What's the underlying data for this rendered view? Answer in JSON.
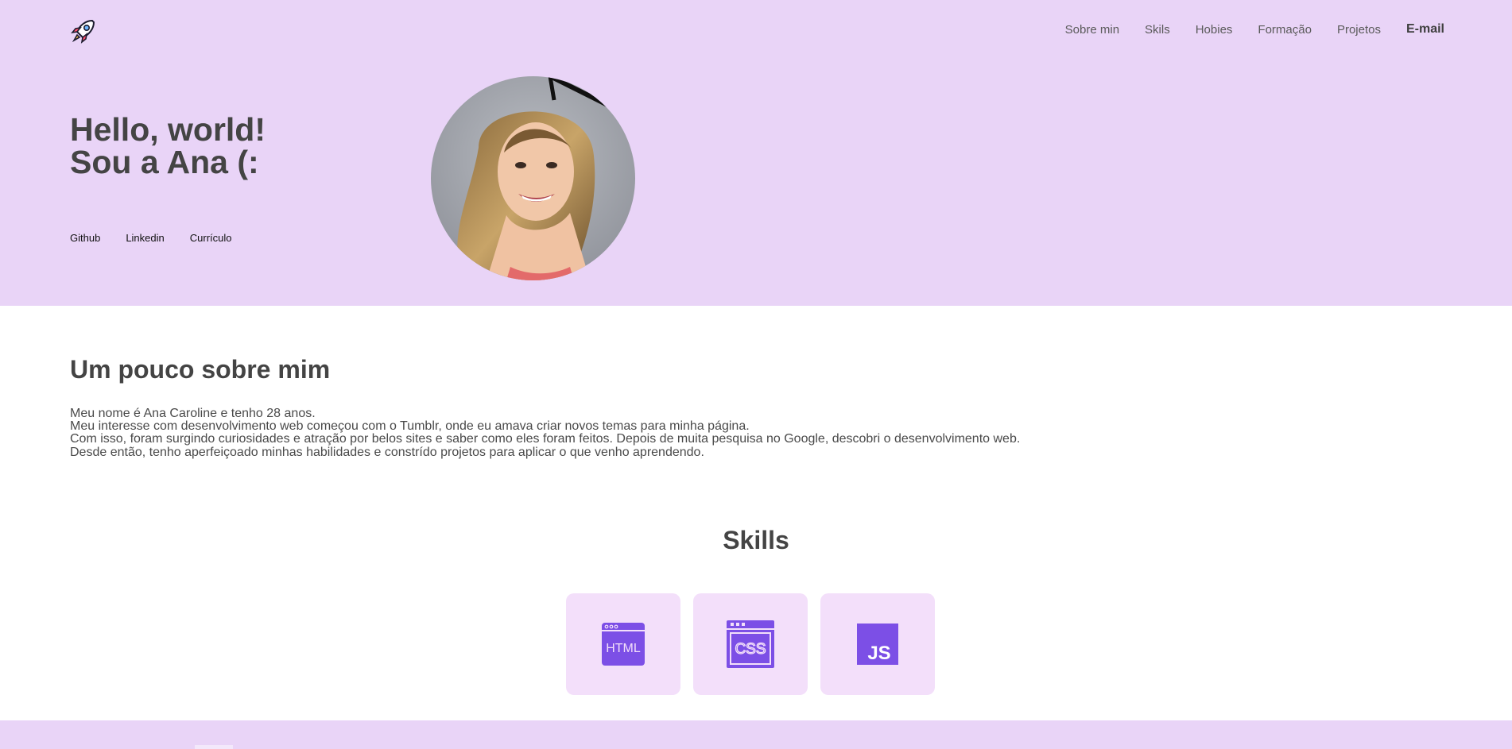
{
  "nav": {
    "items": [
      "Sobre min",
      "Skils",
      "Hobies",
      "Formação",
      "Projetos"
    ],
    "email_label": "E-mail",
    "logo_icon": "rocket-icon"
  },
  "hero": {
    "line1": "Hello, world!",
    "line2": "Sou a Ana (:",
    "links": [
      "Github",
      "Linkedin",
      "Currículo"
    ],
    "photo": "profile-photo"
  },
  "about": {
    "title": "Um pouco sobre mim",
    "paragraphs": [
      "Meu nome é Ana Caroline e tenho 28 anos.",
      "Meu interesse com desenvolvimento web começou com o Tumblr, onde eu amava criar novos temas para minha página.",
      "Com isso, foram surgindo curiosidades e atração por belos sites e saber como eles foram feitos. Depois de muita pesquisa no Google, descobri o desenvolvimento web.",
      "Desde então, tenho aperfeiçoado minhas habilidades e constrído projetos para aplicar o que venho aprendendo."
    ]
  },
  "skills": {
    "title": "Skills",
    "items": [
      {
        "icon": "html-icon",
        "label": "HTML"
      },
      {
        "icon": "css-icon",
        "label": "CSS"
      },
      {
        "icon": "js-icon",
        "label": "JS"
      }
    ]
  },
  "colors": {
    "hero_bg": "#e9d4f7",
    "card_bg": "#f3dffa",
    "icon_purple": "#7c4fe6",
    "text": "#444444"
  }
}
